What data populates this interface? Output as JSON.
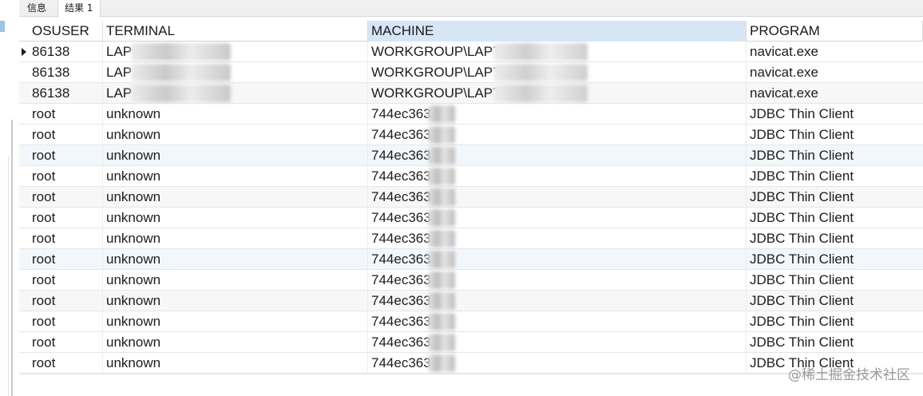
{
  "tabs": [
    {
      "label": "信息"
    },
    {
      "label": "结果 1"
    }
  ],
  "columns": {
    "osuser": "OSUSER",
    "terminal": "TERMINAL",
    "machine": "MACHINE",
    "program": "PROGRAM"
  },
  "rows": [
    {
      "osuser": "86138",
      "terminal": "LAP",
      "machine": "WORKGROUP\\LAPT",
      "program": "navicat.exe"
    },
    {
      "osuser": "86138",
      "terminal": "LAP",
      "machine": "WORKGROUP\\LAPTC",
      "program": "navicat.exe"
    },
    {
      "osuser": "86138",
      "terminal": "LAP",
      "machine": "WORKGROUP\\LAPT",
      "program": "navicat.exe"
    },
    {
      "osuser": "root",
      "terminal": "unknown",
      "machine": "744ec363",
      "program": "JDBC Thin Client"
    },
    {
      "osuser": "root",
      "terminal": "unknown",
      "machine": "744ec3635",
      "program": "JDBC Thin Client"
    },
    {
      "osuser": "root",
      "terminal": "unknown",
      "machine": "744ec3635",
      "program": "JDBC Thin Client"
    },
    {
      "osuser": "root",
      "terminal": "unknown",
      "machine": "744ec363",
      "program": "JDBC Thin Client"
    },
    {
      "osuser": "root",
      "terminal": "unknown",
      "machine": "744ec363",
      "program": "JDBC Thin Client"
    },
    {
      "osuser": "root",
      "terminal": "unknown",
      "machine": "744ec363",
      "program": "JDBC Thin Client"
    },
    {
      "osuser": "root",
      "terminal": "unknown",
      "machine": "744ec363",
      "program": "JDBC Thin Client"
    },
    {
      "osuser": "root",
      "terminal": "unknown",
      "machine": "744ec363",
      "program": "JDBC Thin Client"
    },
    {
      "osuser": "root",
      "terminal": "unknown",
      "machine": "744ec363",
      "program": "JDBC Thin Client"
    },
    {
      "osuser": "root",
      "terminal": "unknown",
      "machine": "744ec3639",
      "program": "JDBC Thin Client"
    },
    {
      "osuser": "root",
      "terminal": "unknown",
      "machine": "744ec363",
      "program": "JDBC Thin Client"
    },
    {
      "osuser": "root",
      "terminal": "unknown",
      "machine": "744ec3638",
      "program": "JDBC Thin Client"
    },
    {
      "osuser": "root",
      "terminal": "unknown",
      "machine": "744ec363",
      "program": "JDBC Thin Client"
    }
  ],
  "watermark": "@稀土掘金技术社区",
  "colors": {
    "header_selected": "#d6e6f5",
    "row_alt": "#f7f7f7",
    "row_highlight": "#f2f7fc"
  },
  "icons": {
    "row_indicator": "current-row-triangle-icon"
  }
}
